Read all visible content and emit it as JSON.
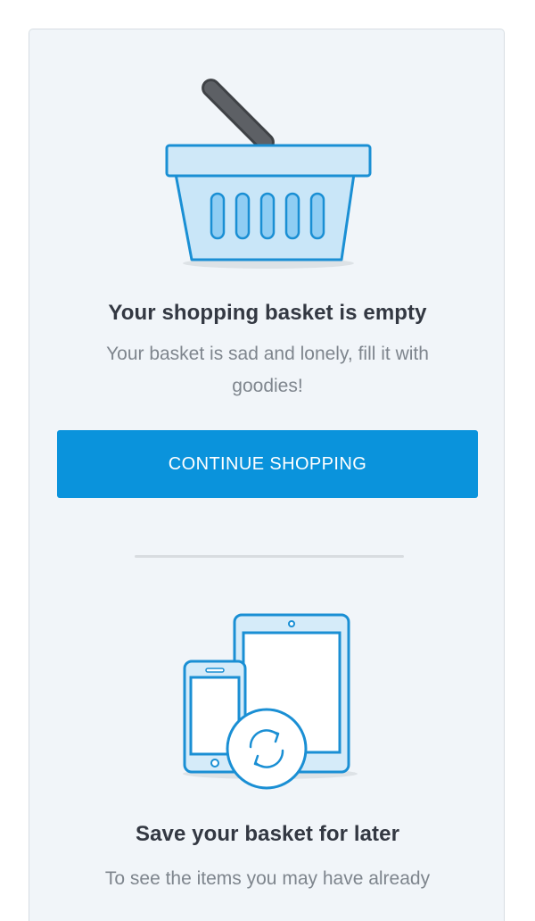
{
  "empty_basket": {
    "title": "Your shopping basket is empty",
    "message": "Your basket is sad and lonely, fill it with goodies!",
    "cta_label": "CONTINUE SHOPPING"
  },
  "save_for_later": {
    "title": "Save your basket for later",
    "message": "To see the items you may have already"
  },
  "icons": {
    "basket": "shopping-basket-icon",
    "devices": "devices-sync-icon",
    "sync": "sync-icon"
  },
  "colors": {
    "accent": "#0a93dc",
    "background": "#f1f5f9",
    "title_text": "#333842",
    "body_text": "#7e858d"
  }
}
